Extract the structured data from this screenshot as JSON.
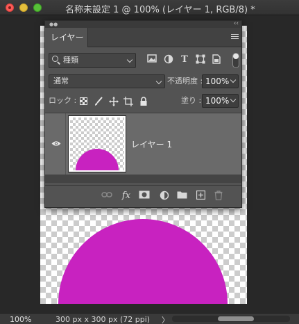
{
  "window": {
    "title": "名称未設定 1 @ 100% (レイヤー 1, RGB/8) *"
  },
  "canvas": {
    "shape_color": "#c822c0"
  },
  "layers_panel": {
    "tab_label": "レイヤー",
    "filter_kind": "種類",
    "filter_icons": [
      "image-filter-icon",
      "adjustment-filter-icon",
      "type-filter-icon",
      "shape-filter-icon",
      "smart-object-filter-icon"
    ],
    "blend_mode": "通常",
    "opacity_label": "不透明度 :",
    "opacity_value": "100%",
    "lock_label": "ロック :",
    "fill_label": "塗り :",
    "fill_value": "100%",
    "layers": [
      {
        "name": "レイヤー 1",
        "visible": true,
        "selected": true
      }
    ],
    "bottom_icons": [
      "link-icon",
      "fx-icon",
      "mask-icon",
      "adjustment-icon",
      "folder-icon",
      "new-layer-icon",
      "trash-icon"
    ],
    "fx_label": "fx"
  },
  "status": {
    "zoom": "100%",
    "doc_info": "300 px x 300 px (72 ppi)",
    "arrow": "〉"
  }
}
